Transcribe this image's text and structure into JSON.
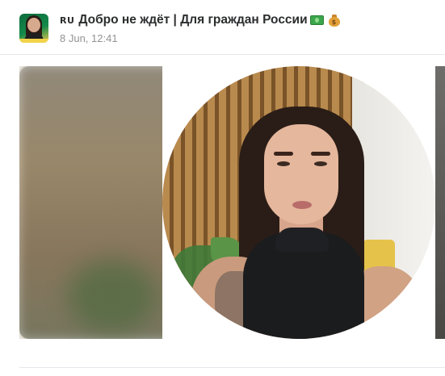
{
  "post": {
    "channel_prefix": "RU",
    "channel_name": "Добро не ждёт | Для граждан России",
    "channel_emojis": [
      "banknote-icon",
      "money-bag-icon"
    ],
    "timestamp": "8 Jun, 12:41"
  },
  "media": {
    "type": "round-video",
    "description_icon": "video-message"
  },
  "colors": {
    "title": "#2c2d2e",
    "timestamp": "#939393",
    "divider": "#e7e8ec"
  }
}
